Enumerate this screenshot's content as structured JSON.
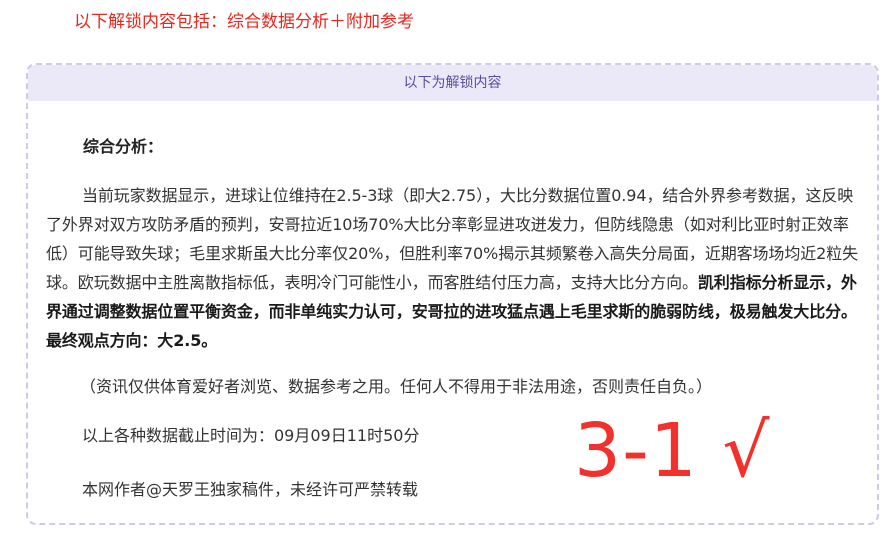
{
  "intro_line": "以下解锁内容包括：综合数据分析＋附加参考",
  "unlock_header": "以下为解锁内容",
  "analysis": {
    "heading": "综合分析：",
    "paragraph_normal": "当前玩家数据显示，进球让位维持在2.5-3球（即大2.75），大比分数据位置0.94，结合外界参考数据，这反映了外界对双方攻防矛盾的预判，安哥拉近10场70%大比分率彰显进攻迸发力，但防线隐患（如对利比亚时射正效率低）可能导致失球；毛里求斯虽大比分率仅20%，但胜利率70%揭示其频繁卷入高失分局面，近期客场场均近2粒失球。欧玩数据中主胜离散指标低，表明冷门可能性小，而客胜结付压力高，支持大比分方向。",
    "paragraph_bold": "凯利指标分析显示，外界通过调整数据位置平衡资金，而非单纯实力认可，安哥拉的进攻猛点遇上毛里求斯的脆弱防线，极易触发大比分。最终观点方向：大2.5。"
  },
  "disclaimer": "（资讯仅供体育爱好者浏览、数据参考之用。任何人不得用于非法用途，否则责任自负。）",
  "cutoff_time": "以上各种数据截止时间为：09月09日11时50分",
  "author_note": "本网作者@天罗王独家稿件，未经许可严禁转载",
  "result_mark": "3-1 √",
  "colors": {
    "accent_red": "#e8261d",
    "header_bg": "#ebe8f7",
    "border": "#cfcae6",
    "header_text": "#5a4e9c"
  }
}
